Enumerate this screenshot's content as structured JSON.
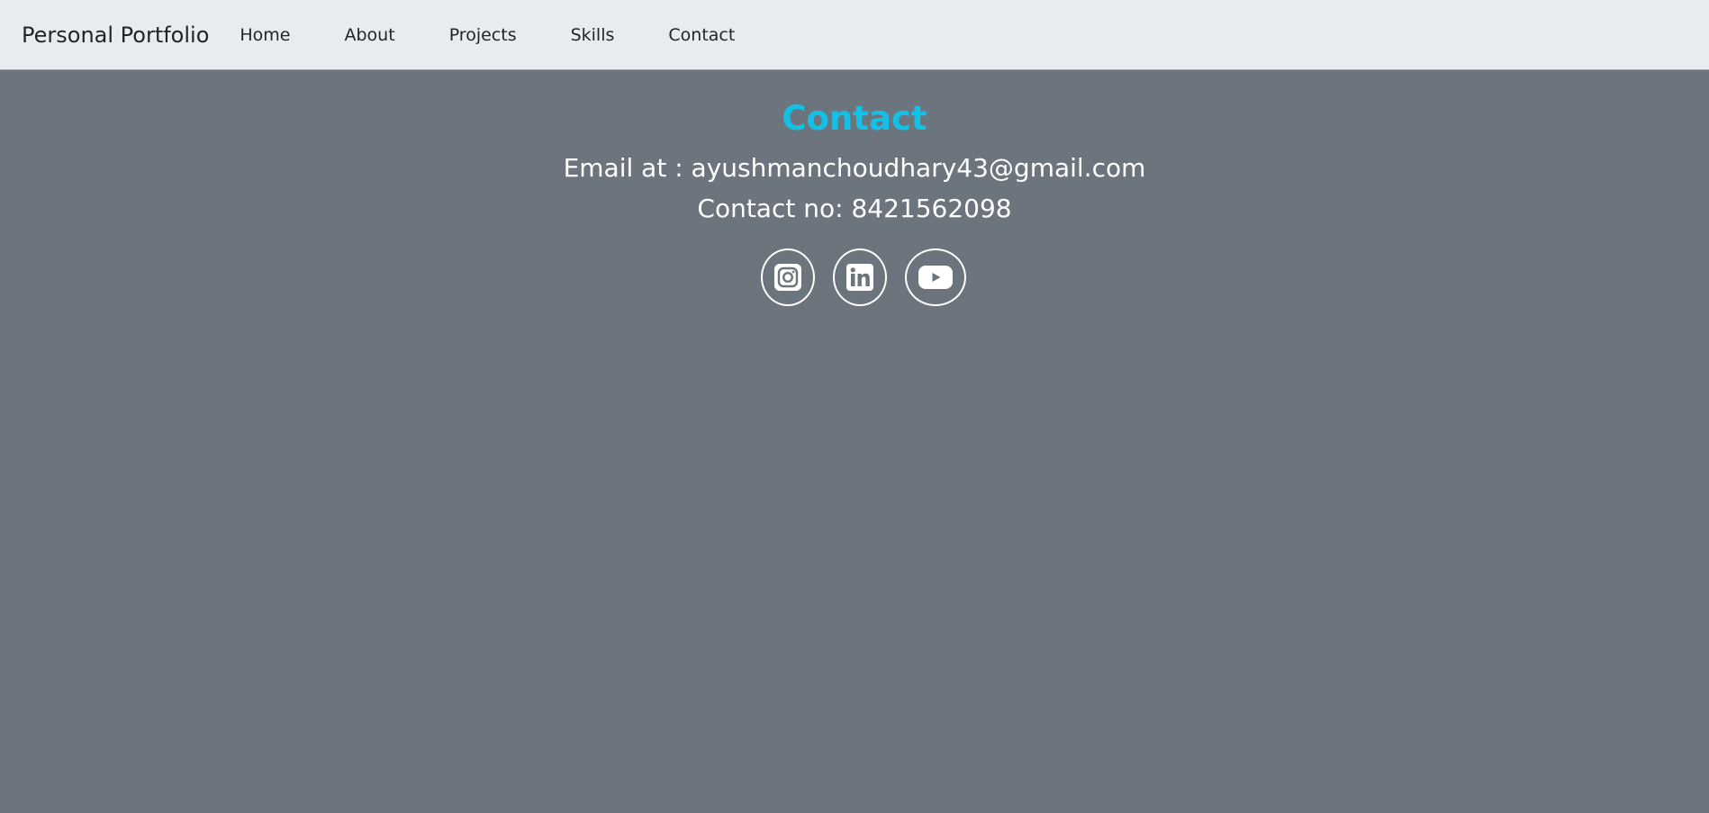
{
  "navbar": {
    "brand": "Personal Portfolio",
    "links": [
      {
        "label": "Home"
      },
      {
        "label": "About"
      },
      {
        "label": "Projects"
      },
      {
        "label": "Skills"
      },
      {
        "label": "Contact"
      }
    ]
  },
  "contact": {
    "title": "Contact",
    "email_line": "Email at : ayushmanchoudhary43@gmail.com",
    "phone_line": "Contact no: 8421562098",
    "socials": [
      {
        "icon": "instagram-icon"
      },
      {
        "icon": "linkedin-icon"
      },
      {
        "icon": "youtube-icon"
      }
    ]
  },
  "colors": {
    "navbar_bg": "#e9ecef",
    "page_bg": "#6c757d",
    "title": "#15c0e6",
    "text": "#ffffff"
  }
}
